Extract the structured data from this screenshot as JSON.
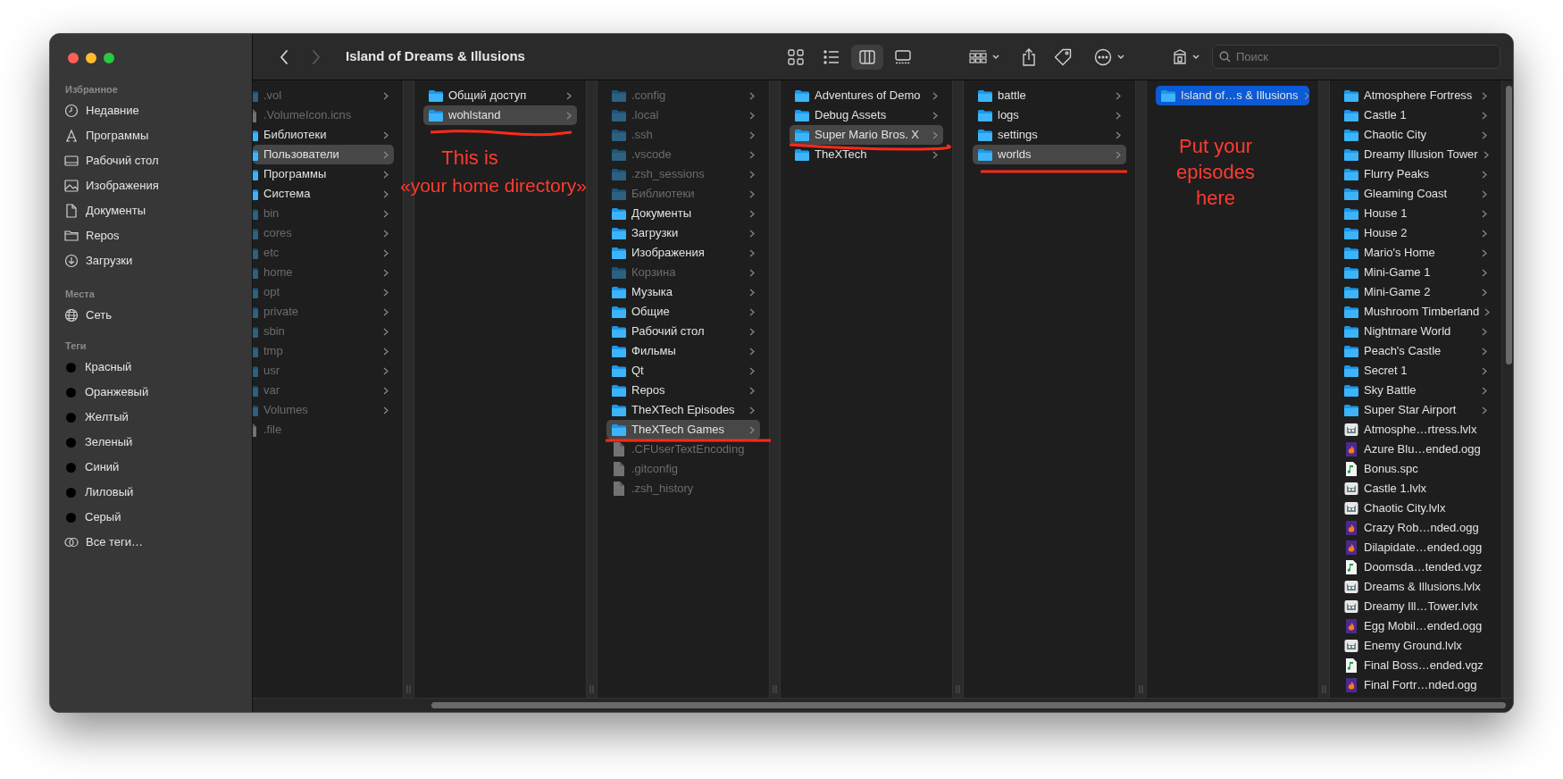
{
  "window": {
    "title": "Island of Dreams & Illusions"
  },
  "toolbar": {
    "back_enabled": true,
    "forward_enabled": false,
    "views": [
      {
        "kind": "icons",
        "selected": false
      },
      {
        "kind": "list",
        "selected": false
      },
      {
        "kind": "columns",
        "selected": true
      },
      {
        "kind": "gallery",
        "selected": false
      }
    ],
    "search": {
      "placeholder": "Поиск"
    }
  },
  "sidebar": {
    "sections": [
      {
        "heading": "Избранное",
        "items": [
          {
            "label": "Недавние",
            "kind": "clock"
          },
          {
            "label": "Программы",
            "kind": "apps"
          },
          {
            "label": "Рабочий стол",
            "kind": "desktop"
          },
          {
            "label": "Изображения",
            "kind": "photo"
          },
          {
            "label": "Документы",
            "kind": "document"
          },
          {
            "label": "Repos",
            "kind": "folder"
          },
          {
            "label": "Загрузки",
            "kind": "download"
          }
        ]
      },
      {
        "heading": "Места",
        "items": [
          {
            "label": "Сеть",
            "kind": "globe"
          }
        ]
      },
      {
        "heading": "Теги",
        "items": [
          {
            "label": "Красный",
            "kind": "tag"
          },
          {
            "label": "Оранжевый",
            "kind": "tag"
          },
          {
            "label": "Желтый",
            "kind": "tag"
          },
          {
            "label": "Зеленый",
            "kind": "tag"
          },
          {
            "label": "Синий",
            "kind": "tag"
          },
          {
            "label": "Лиловый",
            "kind": "tag"
          },
          {
            "label": "Серый",
            "kind": "tag"
          },
          {
            "label": "Все теги…",
            "kind": "all-tags"
          }
        ]
      }
    ]
  },
  "columns": [
    {
      "items": [
        {
          "name": ".vol",
          "kind": "folder",
          "hidden": true,
          "selected": false
        },
        {
          "name": ".VolumeIcon.icns",
          "kind": "file",
          "hidden": true,
          "selected": false
        },
        {
          "name": "Библиотеки",
          "kind": "folder",
          "hidden": false,
          "selected": false
        },
        {
          "name": "Пользователи",
          "kind": "folder",
          "hidden": false,
          "selected": true
        },
        {
          "name": "Программы",
          "kind": "folder",
          "hidden": false,
          "selected": false
        },
        {
          "name": "Система",
          "kind": "folder",
          "hidden": false,
          "selected": false
        },
        {
          "name": "bin",
          "kind": "folder",
          "hidden": true,
          "selected": false
        },
        {
          "name": "cores",
          "kind": "folder",
          "hidden": true,
          "selected": false
        },
        {
          "name": "etc",
          "kind": "folder",
          "hidden": true,
          "selected": false
        },
        {
          "name": "home",
          "kind": "folder",
          "hidden": true,
          "selected": false
        },
        {
          "name": "opt",
          "kind": "folder",
          "hidden": true,
          "selected": false
        },
        {
          "name": "private",
          "kind": "folder",
          "hidden": true,
          "selected": false
        },
        {
          "name": "sbin",
          "kind": "folder",
          "hidden": true,
          "selected": false
        },
        {
          "name": "tmp",
          "kind": "folder",
          "hidden": true,
          "selected": false
        },
        {
          "name": "usr",
          "kind": "folder",
          "hidden": true,
          "selected": false
        },
        {
          "name": "var",
          "kind": "folder",
          "hidden": true,
          "selected": false
        },
        {
          "name": "Volumes",
          "kind": "folder",
          "hidden": true,
          "selected": false
        },
        {
          "name": ".file",
          "kind": "file",
          "hidden": true,
          "selected": false
        }
      ]
    },
    {
      "items": [
        {
          "name": "Общий доступ",
          "kind": "folder",
          "hidden": false,
          "selected": false
        },
        {
          "name": "wohlstand",
          "kind": "folder",
          "hidden": false,
          "selected": true
        }
      ]
    },
    {
      "items": [
        {
          "name": ".config",
          "kind": "folder",
          "hidden": true,
          "selected": false
        },
        {
          "name": ".local",
          "kind": "folder",
          "hidden": true,
          "selected": false
        },
        {
          "name": ".ssh",
          "kind": "folder",
          "hidden": true,
          "selected": false
        },
        {
          "name": ".vscode",
          "kind": "folder",
          "hidden": true,
          "selected": false
        },
        {
          "name": ".zsh_sessions",
          "kind": "folder",
          "hidden": true,
          "selected": false
        },
        {
          "name": "Библиотеки",
          "kind": "folder",
          "hidden": true,
          "selected": false
        },
        {
          "name": "Документы",
          "kind": "folder",
          "hidden": false,
          "selected": false
        },
        {
          "name": "Загрузки",
          "kind": "folder",
          "hidden": false,
          "selected": false
        },
        {
          "name": "Изображения",
          "kind": "folder",
          "hidden": false,
          "selected": false
        },
        {
          "name": "Корзина",
          "kind": "folder",
          "hidden": true,
          "selected": false
        },
        {
          "name": "Музыка",
          "kind": "folder",
          "hidden": false,
          "selected": false
        },
        {
          "name": "Общие",
          "kind": "folder",
          "hidden": false,
          "selected": false
        },
        {
          "name": "Рабочий стол",
          "kind": "folder",
          "hidden": false,
          "selected": false
        },
        {
          "name": "Фильмы",
          "kind": "folder",
          "hidden": false,
          "selected": false
        },
        {
          "name": "Qt",
          "kind": "folder",
          "hidden": false,
          "selected": false
        },
        {
          "name": "Repos",
          "kind": "folder",
          "hidden": false,
          "selected": false
        },
        {
          "name": "TheXTech Episodes",
          "kind": "folder",
          "hidden": false,
          "selected": false
        },
        {
          "name": "TheXTech Games",
          "kind": "folder",
          "hidden": false,
          "selected": true
        },
        {
          "name": ".CFUserTextEncoding",
          "kind": "file",
          "hidden": true,
          "selected": false
        },
        {
          "name": ".gitconfig",
          "kind": "file",
          "hidden": true,
          "selected": false
        },
        {
          "name": ".zsh_history",
          "kind": "file",
          "hidden": true,
          "selected": false
        }
      ]
    },
    {
      "items": [
        {
          "name": "Adventures of Demo",
          "kind": "folder",
          "hidden": false,
          "selected": false
        },
        {
          "name": "Debug Assets",
          "kind": "folder",
          "hidden": false,
          "selected": false
        },
        {
          "name": "Super Mario Bros. X",
          "kind": "folder",
          "hidden": false,
          "selected": true
        },
        {
          "name": "TheXTech",
          "kind": "folder",
          "hidden": false,
          "selected": false
        }
      ]
    },
    {
      "items": [
        {
          "name": "battle",
          "kind": "folder",
          "hidden": false,
          "selected": false
        },
        {
          "name": "logs",
          "kind": "folder",
          "hidden": false,
          "selected": false
        },
        {
          "name": "settings",
          "kind": "folder",
          "hidden": false,
          "selected": false
        },
        {
          "name": "worlds",
          "kind": "folder",
          "hidden": false,
          "selected": true
        }
      ]
    },
    {
      "items": [
        {
          "name": "Island of…s & Illusions",
          "kind": "folder",
          "hidden": false,
          "selected": true
        }
      ]
    },
    {
      "items": [
        {
          "name": "Atmosphere Fortress",
          "kind": "folder",
          "hidden": false,
          "selected": false
        },
        {
          "name": "Castle 1",
          "kind": "folder",
          "hidden": false,
          "selected": false
        },
        {
          "name": "Chaotic City",
          "kind": "folder",
          "hidden": false,
          "selected": false
        },
        {
          "name": "Dreamy Illusion Tower",
          "kind": "folder",
          "hidden": false,
          "selected": false
        },
        {
          "name": "Flurry Peaks",
          "kind": "folder",
          "hidden": false,
          "selected": false
        },
        {
          "name": "Gleaming Coast",
          "kind": "folder",
          "hidden": false,
          "selected": false
        },
        {
          "name": "House 1",
          "kind": "folder",
          "hidden": false,
          "selected": false
        },
        {
          "name": "House 2",
          "kind": "folder",
          "hidden": false,
          "selected": false
        },
        {
          "name": "Mario's Home",
          "kind": "folder",
          "hidden": false,
          "selected": false
        },
        {
          "name": "Mini-Game 1",
          "kind": "folder",
          "hidden": false,
          "selected": false
        },
        {
          "name": "Mini-Game 2",
          "kind": "folder",
          "hidden": false,
          "selected": false
        },
        {
          "name": "Mushroom Timberland",
          "kind": "folder",
          "hidden": false,
          "selected": false
        },
        {
          "name": "Nightmare World",
          "kind": "folder",
          "hidden": false,
          "selected": false
        },
        {
          "name": "Peach's Castle",
          "kind": "folder",
          "hidden": false,
          "selected": false
        },
        {
          "name": "Secret 1",
          "kind": "folder",
          "hidden": false,
          "selected": false
        },
        {
          "name": "Sky Battle",
          "kind": "folder",
          "hidden": false,
          "selected": false
        },
        {
          "name": "Super Star Airport",
          "kind": "folder",
          "hidden": false,
          "selected": false
        },
        {
          "name": "Atmosphe…rtress.lvlx",
          "kind": "level",
          "hidden": false,
          "selected": false
        },
        {
          "name": "Azure Blu…ended.ogg",
          "kind": "audio",
          "hidden": false,
          "selected": false
        },
        {
          "name": "Bonus.spc",
          "kind": "music",
          "hidden": false,
          "selected": false
        },
        {
          "name": "Castle 1.lvlx",
          "kind": "level",
          "hidden": false,
          "selected": false
        },
        {
          "name": "Chaotic City.lvlx",
          "kind": "level",
          "hidden": false,
          "selected": false
        },
        {
          "name": "Crazy Rob…nded.ogg",
          "kind": "audio",
          "hidden": false,
          "selected": false
        },
        {
          "name": "Dilapidate…ended.ogg",
          "kind": "audio",
          "hidden": false,
          "selected": false
        },
        {
          "name": "Doomsda…tended.vgz",
          "kind": "music",
          "hidden": false,
          "selected": false
        },
        {
          "name": "Dreams & Illusions.lvlx",
          "kind": "level",
          "hidden": false,
          "selected": false
        },
        {
          "name": "Dreamy Ill…Tower.lvlx",
          "kind": "level",
          "hidden": false,
          "selected": false
        },
        {
          "name": "Egg Mobil…ended.ogg",
          "kind": "audio",
          "hidden": false,
          "selected": false
        },
        {
          "name": "Enemy Ground.lvlx",
          "kind": "level",
          "hidden": false,
          "selected": false
        },
        {
          "name": "Final Boss…ended.vgz",
          "kind": "music",
          "hidden": false,
          "selected": false
        },
        {
          "name": "Final Fortr…nded.ogg",
          "kind": "audio",
          "hidden": false,
          "selected": false
        }
      ]
    }
  ],
  "annotations": [
    {
      "text": "This is"
    },
    {
      "text": "«your home directory»"
    },
    {
      "text": "Put your episodes here"
    }
  ]
}
